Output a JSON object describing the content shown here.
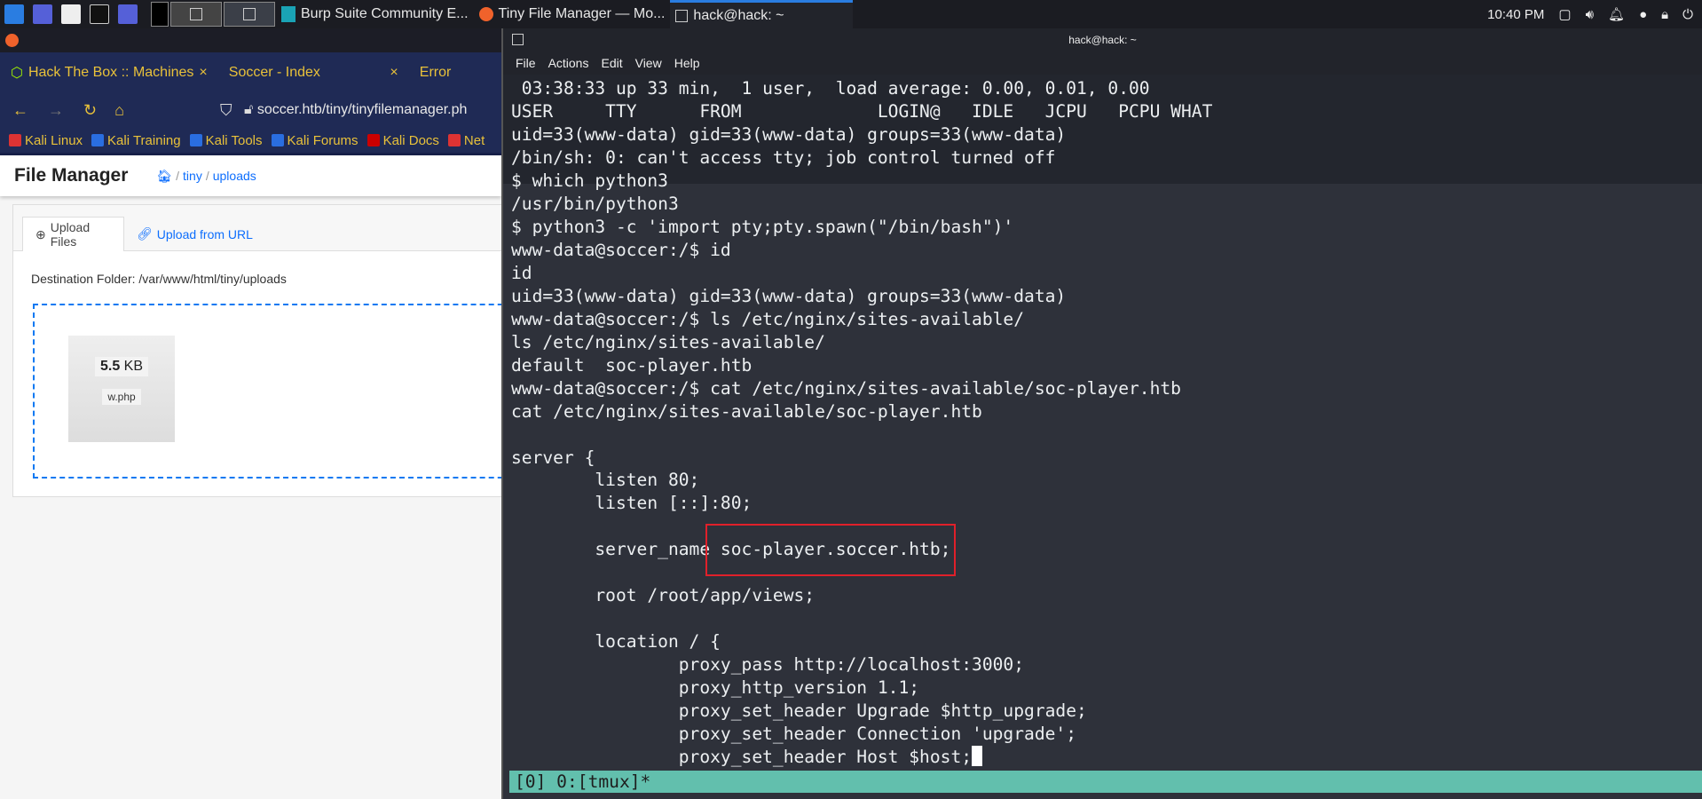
{
  "taskbar": {
    "tasks": [
      {
        "label": "Burp Suite Community E...",
        "icon": "burp-icon"
      },
      {
        "label": "Tiny File Manager — Mo...",
        "icon": "firefox-icon"
      },
      {
        "label": "hack@hack: ~",
        "icon": "terminal-icon"
      }
    ],
    "clock": "10:40 PM"
  },
  "browser": {
    "tabs": [
      {
        "label": "Hack The Box :: Machines"
      },
      {
        "label": "Soccer - Index"
      },
      {
        "label": "Error"
      }
    ],
    "url": "soccer.htb/tiny/tinyfilemanager.ph",
    "bookmarks": [
      "Kali Linux",
      "Kali Training",
      "Kali Tools",
      "Kali Forums",
      "Kali Docs",
      "Net"
    ]
  },
  "file_manager": {
    "title": "File Manager",
    "breadcrumb": [
      "tiny",
      "uploads"
    ],
    "tabs": [
      "Upload Files",
      "Upload from URL"
    ],
    "destination": "Destination Folder: /var/www/html/tiny/uploads",
    "file": {
      "size": "5.5",
      "unit": "KB",
      "name": "w.php"
    }
  },
  "terminal": {
    "title": "hack@hack: ~",
    "menu": [
      "File",
      "Actions",
      "Edit",
      "View",
      "Help"
    ],
    "lines": [
      " 03:38:33 up 33 min,  1 user,  load average: 0.00, 0.01, 0.00",
      "USER     TTY      FROM             LOGIN@   IDLE   JCPU   PCPU WHAT",
      "uid=33(www-data) gid=33(www-data) groups=33(www-data)",
      "/bin/sh: 0: can't access tty; job control turned off",
      "$ which python3",
      "/usr/bin/python3",
      "$ python3 -c 'import pty;pty.spawn(\"/bin/bash\")'",
      "www-data@soccer:/$ id",
      "id",
      "uid=33(www-data) gid=33(www-data) groups=33(www-data)",
      "www-data@soccer:/$ ls /etc/nginx/sites-available/",
      "ls /etc/nginx/sites-available/",
      "default  soc-player.htb",
      "www-data@soccer:/$ cat /etc/nginx/sites-available/soc-player.htb",
      "cat /etc/nginx/sites-available/soc-player.htb",
      "",
      "server {",
      "        listen 80;",
      "        listen [::]:80;",
      "",
      "        server_name soc-player.soccer.htb;",
      "",
      "        root /root/app/views;",
      "",
      "        location / {",
      "                proxy_pass http://localhost:3000;",
      "                proxy_http_version 1.1;",
      "                proxy_set_header Upgrade $http_upgrade;",
      "                proxy_set_header Connection 'upgrade';",
      "                proxy_set_header Host $host;"
    ],
    "status_bar": "[0] 0:[tmux]*",
    "status_color": "#62bfad",
    "highlight_color": "#e0202a"
  }
}
